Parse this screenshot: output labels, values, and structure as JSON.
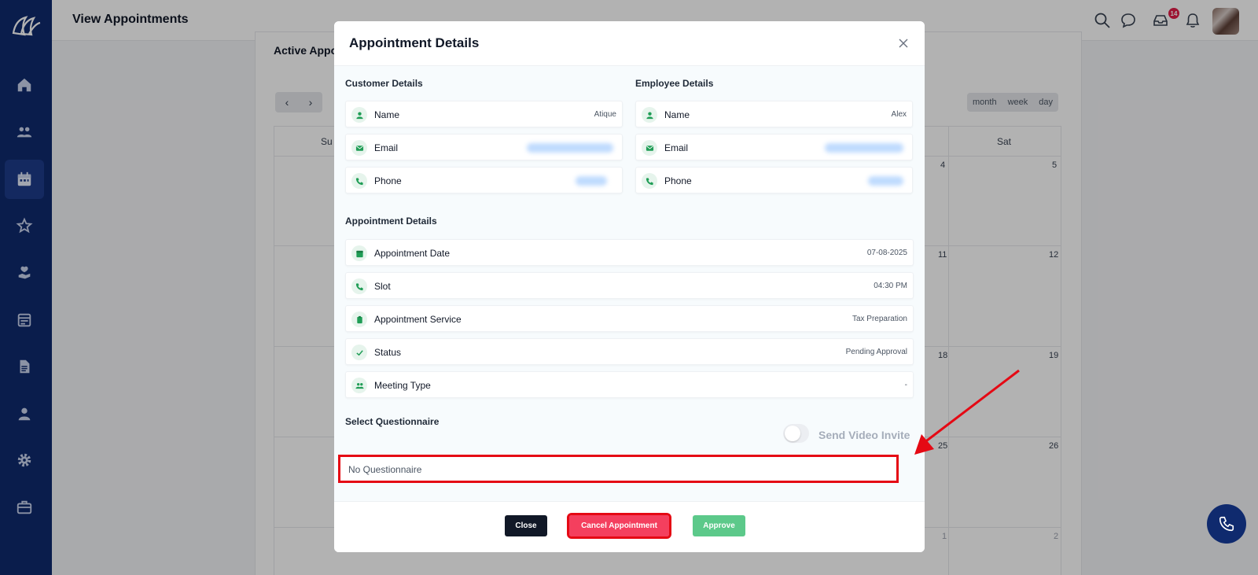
{
  "topbar": {
    "title": "View Appointments",
    "notification_count": "14"
  },
  "background": {
    "heading": "Active Appo",
    "nav_prev": "‹",
    "nav_next": "›",
    "views": [
      "month",
      "week",
      "day"
    ],
    "day_headers": {
      "sun": "Su",
      "sat": "Sat"
    },
    "dates": {
      "r1c6": "4",
      "r1c7": "5",
      "r2c6": "11",
      "r2c7": "12",
      "r3c6": "18",
      "r3c7": "19",
      "r4c6": "25",
      "r4c7": "26",
      "r5c6": "1",
      "r5c7": "2"
    }
  },
  "modal": {
    "title": "Appointment Details",
    "customer": {
      "heading": "Customer Details",
      "rows": [
        {
          "label": "Name",
          "value": "Atique"
        },
        {
          "label": "Email",
          "value": ""
        },
        {
          "label": "Phone",
          "value": ""
        }
      ]
    },
    "employee": {
      "heading": "Employee Details",
      "rows": [
        {
          "label": "Name",
          "value": "Alex"
        },
        {
          "label": "Email",
          "value": ""
        },
        {
          "label": "Phone",
          "value": ""
        }
      ]
    },
    "appointment": {
      "heading": "Appointment Details",
      "rows": [
        {
          "label": "Appointment Date",
          "value": "07-08-2025"
        },
        {
          "label": "Slot",
          "value": "04:30 PM"
        },
        {
          "label": "Appointment Service",
          "value": "Tax Preparation"
        },
        {
          "label": "Status",
          "value": "Pending Approval"
        },
        {
          "label": "Meeting Type",
          "value": "-"
        }
      ]
    },
    "questionnaire": {
      "label": "Select Questionnaire",
      "selected": "No Questionnaire"
    },
    "video_invite_label": "Send Video Invite",
    "buttons": {
      "close": "Close",
      "cancel": "Cancel Appointment",
      "approve": "Approve"
    }
  },
  "colors": {
    "sidebar": "#0f2a6e",
    "accent_green": "#1f9d55",
    "cancel": "#f43f5e",
    "approve": "#5cc98a",
    "highlight": "#e50914"
  }
}
